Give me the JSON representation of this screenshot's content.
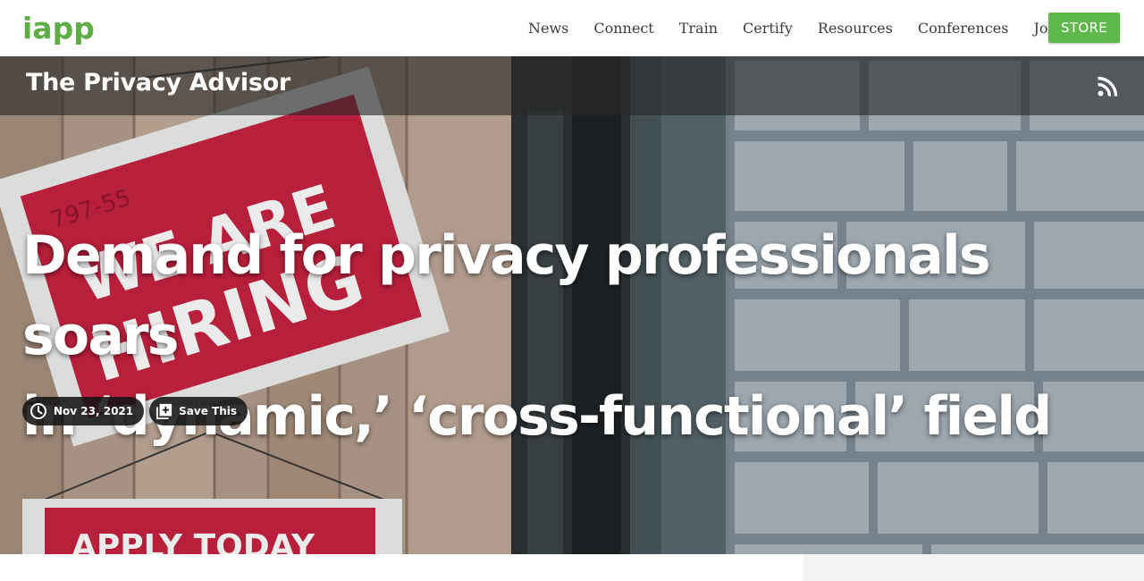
{
  "header": {
    "logo": "iapp",
    "nav": [
      "News",
      "Connect",
      "Train",
      "Certify",
      "Resources",
      "Conferences",
      "Join"
    ],
    "store_label": "STORE"
  },
  "hero": {
    "section_title": "The Privacy Advisor",
    "headline_line1": "Demand for privacy professionals soars",
    "headline_line2": "in ‘dynamic,’ ‘cross-functional’ field",
    "date": "Nov 23, 2021",
    "save_label": "Save This",
    "sign_main": "WE ARE HIRING",
    "sign_bottom": "APPLY TODAY",
    "sign_small": "797-55",
    "rss_icon": "rss-icon"
  },
  "colors": {
    "brand_green": "#5fae45",
    "store_green": "#5fb84a",
    "sign_red": "#c8223f"
  }
}
